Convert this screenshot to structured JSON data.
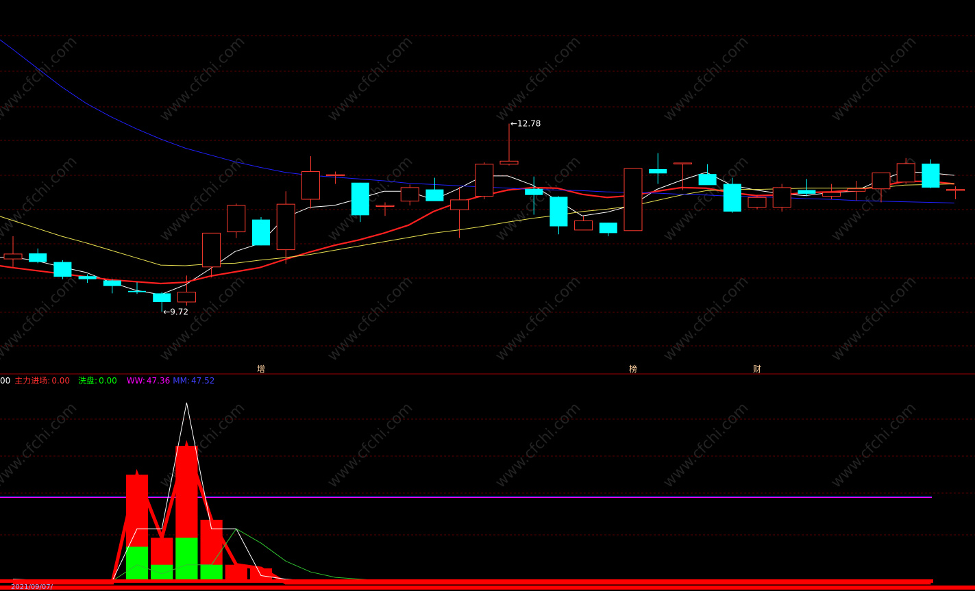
{
  "colors": {
    "background": "#000000",
    "up": "#ff3b30",
    "down": "#00ffff",
    "ma_white": "#ffffff",
    "ma_red": "#ff2020",
    "ma_yellow": "#e8e050",
    "ma_blue": "#2020ff",
    "grid": "#5a0000",
    "divider": "#a00000"
  },
  "watermark": "www.cfchi.com",
  "legend": {
    "lead": "00",
    "main_label": "主力进场:",
    "main_value": "0.00",
    "wash_label": "洗盘:",
    "wash_value": "0.00",
    "ww_label": "WW:",
    "ww_value": "47.36",
    "mm_label": "MM:",
    "mm_value": "47.52"
  },
  "date_fragment": "2021/09/07/",
  "chart_data": [
    {
      "type": "candlestick",
      "ylim": [
        9.0,
        14.3
      ],
      "annotations": [
        {
          "text": "12.78",
          "x": 20
        },
        {
          "text": "9.72",
          "x": 6
        }
      ],
      "markers": [
        {
          "text": "增",
          "x": 10
        },
        {
          "text": "榜",
          "x": 25
        },
        {
          "text": "财",
          "x": 30
        }
      ],
      "candles": [
        {
          "o": 10.58,
          "h": 10.95,
          "l": 10.45,
          "c": 10.66
        },
        {
          "o": 10.67,
          "h": 10.75,
          "l": 10.51,
          "c": 10.53
        },
        {
          "o": 10.53,
          "h": 10.56,
          "l": 10.25,
          "c": 10.29
        },
        {
          "o": 10.3,
          "h": 10.33,
          "l": 10.19,
          "c": 10.25
        },
        {
          "o": 10.23,
          "h": 10.25,
          "l": 10.02,
          "c": 10.14
        },
        {
          "o": 10.06,
          "h": 10.2,
          "l": 10.01,
          "c": 10.04
        },
        {
          "o": 10.02,
          "h": 10.04,
          "l": 9.72,
          "c": 9.88
        },
        {
          "o": 9.88,
          "h": 10.31,
          "l": 9.82,
          "c": 10.04
        },
        {
          "o": 10.45,
          "h": 10.95,
          "l": 10.28,
          "c": 11.0
        },
        {
          "o": 11.02,
          "h": 11.48,
          "l": 10.92,
          "c": 11.45
        },
        {
          "o": 11.22,
          "h": 11.26,
          "l": 10.8,
          "c": 10.8
        },
        {
          "o": 10.73,
          "h": 11.68,
          "l": 10.5,
          "c": 11.47
        },
        {
          "o": 11.55,
          "h": 12.25,
          "l": 11.4,
          "c": 12.0
        },
        {
          "o": 11.95,
          "h": 12.0,
          "l": 11.8,
          "c": 11.95
        },
        {
          "o": 11.82,
          "h": 11.82,
          "l": 11.18,
          "c": 11.29
        },
        {
          "o": 11.45,
          "h": 11.5,
          "l": 11.28,
          "c": 11.45
        },
        {
          "o": 11.52,
          "h": 11.79,
          "l": 11.45,
          "c": 11.74
        },
        {
          "o": 11.71,
          "h": 11.9,
          "l": 11.55,
          "c": 11.52
        },
        {
          "o": 11.38,
          "h": 11.75,
          "l": 10.92,
          "c": 11.54
        },
        {
          "o": 11.6,
          "h": 12.15,
          "l": 11.55,
          "c": 12.12
        },
        {
          "o": 12.12,
          "h": 12.78,
          "l": 12.1,
          "c": 12.17
        },
        {
          "o": 11.72,
          "h": 11.92,
          "l": 11.3,
          "c": 11.62
        },
        {
          "o": 11.59,
          "h": 11.6,
          "l": 10.98,
          "c": 11.11
        },
        {
          "o": 11.05,
          "h": 11.28,
          "l": 11.05,
          "c": 11.2
        },
        {
          "o": 11.17,
          "h": 11.17,
          "l": 10.95,
          "c": 11.0
        },
        {
          "o": 11.04,
          "h": 12.05,
          "l": 11.04,
          "c": 12.05
        },
        {
          "o": 12.04,
          "h": 12.3,
          "l": 11.8,
          "c": 11.97
        },
        {
          "o": 12.14,
          "h": 12.14,
          "l": 11.7,
          "c": 12.14
        },
        {
          "o": 11.96,
          "h": 12.12,
          "l": 11.85,
          "c": 11.78
        },
        {
          "o": 11.8,
          "h": 11.9,
          "l": 11.33,
          "c": 11.35
        },
        {
          "o": 11.42,
          "h": 11.62,
          "l": 11.39,
          "c": 11.58
        },
        {
          "o": 11.42,
          "h": 11.8,
          "l": 11.35,
          "c": 11.74
        },
        {
          "o": 11.7,
          "h": 11.88,
          "l": 11.6,
          "c": 11.64
        },
        {
          "o": 11.6,
          "h": 11.8,
          "l": 11.55,
          "c": 11.66
        },
        {
          "o": 11.68,
          "h": 11.85,
          "l": 11.53,
          "c": 11.72
        },
        {
          "o": 11.72,
          "h": 11.98,
          "l": 11.5,
          "c": 11.98
        },
        {
          "o": 11.83,
          "h": 12.22,
          "l": 11.8,
          "c": 12.13
        },
        {
          "o": 12.13,
          "h": 12.2,
          "l": 11.73,
          "c": 11.74
        },
        {
          "o": 11.7,
          "h": 11.76,
          "l": 11.55,
          "c": 11.71
        }
      ],
      "series": [
        {
          "values": [
            10.6,
            10.61,
            10.55,
            10.45,
            10.36,
            10.2,
            10.07,
            10.0,
            10.16,
            10.42,
            10.7,
            10.83,
            11.25,
            11.42,
            11.45,
            11.56,
            11.68,
            11.68,
            11.54,
            11.72,
            11.93,
            11.93,
            11.78,
            11.53,
            11.28,
            11.34,
            11.45,
            11.71,
            11.86,
            11.99,
            11.78,
            11.7,
            11.64,
            11.61,
            11.66,
            11.68,
            11.86,
            12.0,
            11.98,
            11.94
          ]
        },
        {
          "values": [
            10.5,
            10.44,
            10.39,
            10.34,
            10.29,
            10.24,
            10.21,
            10.18,
            10.2,
            10.3,
            10.37,
            10.44,
            10.57,
            10.69,
            10.8,
            10.89,
            11.0,
            11.13,
            11.35,
            11.5,
            11.61,
            11.7,
            11.74,
            11.73,
            11.63,
            11.58,
            11.61,
            11.68,
            11.74,
            11.73,
            11.66,
            11.61,
            11.62,
            11.66,
            11.67,
            11.7,
            11.76,
            11.84,
            11.84,
            11.8
          ]
        },
        {
          "values": [
            11.34,
            11.21,
            11.08,
            10.95,
            10.84,
            10.72,
            10.6,
            10.48,
            10.47,
            10.5,
            10.51,
            10.56,
            10.6,
            10.65,
            10.72,
            10.79,
            10.86,
            10.93,
            11.0,
            11.05,
            11.11,
            11.18,
            11.24,
            11.29,
            11.35,
            11.39,
            11.44,
            11.53,
            11.62,
            11.69,
            11.71,
            11.71,
            11.72,
            11.73,
            11.73,
            11.73,
            11.74,
            11.78,
            11.79,
            11.8
          ]
        },
        {
          "values": [
            14.3,
            14.0,
            13.69,
            13.38,
            13.11,
            12.89,
            12.7,
            12.53,
            12.38,
            12.27,
            12.16,
            12.07,
            11.99,
            11.94,
            11.91,
            11.88,
            11.85,
            11.81,
            11.79,
            11.77,
            11.75,
            11.73,
            11.71,
            11.7,
            11.69,
            11.67,
            11.66,
            11.65,
            11.63,
            11.62,
            11.6,
            11.59,
            11.58,
            11.56,
            11.55,
            11.53,
            11.52,
            11.51,
            11.5,
            11.49
          ]
        }
      ]
    },
    {
      "type": "area",
      "ylim": [
        0,
        100
      ],
      "series": [
        {
          "name": "WW",
          "values": [
            47.36,
            47.36,
            47.36,
            47.36,
            47.36,
            47.36,
            47.36,
            47.36,
            47.36,
            47.36,
            47.36,
            47.36,
            47.36,
            47.36,
            47.36,
            47.36,
            47.36,
            47.36,
            47.36,
            47.36,
            47.36,
            47.36,
            47.36,
            47.36,
            47.36,
            47.36,
            47.36,
            47.36,
            47.36,
            47.36,
            47.36,
            47.36,
            47.36,
            47.36,
            47.36,
            47.36,
            47.36
          ]
        },
        {
          "name": "MM",
          "values": [
            47.52,
            47.52,
            47.52,
            47.52,
            47.52,
            47.52,
            47.52,
            47.52,
            47.52,
            47.52,
            47.52,
            47.52,
            47.52,
            47.52,
            47.52,
            47.52,
            47.52,
            47.52,
            47.52,
            47.52,
            47.52,
            47.52,
            47.52,
            47.52,
            47.52,
            47.52,
            47.52,
            47.52,
            47.52,
            47.52,
            47.52,
            47.52,
            47.52,
            47.52,
            47.52,
            47.52,
            47.52
          ]
        },
        {
          "values": [
            2,
            1.5,
            1,
            1,
            1,
            30,
            30,
            100,
            30,
            30,
            4,
            2,
            1,
            0.5,
            0.3,
            0.3,
            0.3,
            0.3,
            0.3,
            0.3,
            0.3,
            0.3,
            0.3,
            0.3,
            0.3,
            0.3,
            0.3,
            0.3,
            0.3,
            0.3,
            0.3,
            0.3,
            0.3,
            0.3,
            0.3,
            0.3,
            0.3,
            0.3
          ]
        },
        {
          "values": [
            1.5,
            1,
            1,
            1,
            1,
            10,
            5,
            10,
            10,
            30,
            22,
            12,
            6,
            3,
            2,
            1,
            1,
            1,
            1,
            1,
            1,
            1,
            1,
            1,
            1,
            1,
            1,
            1,
            1,
            1,
            1,
            1,
            1,
            1,
            1,
            1,
            1,
            1
          ]
        },
        {
          "name": "主力进场",
          "values": [
            0,
            0,
            0,
            0,
            0,
            60,
            25,
            76,
            35,
            10,
            8,
            0,
            0,
            0,
            0,
            0,
            0,
            0,
            0,
            0,
            0,
            0,
            0,
            0,
            0,
            0,
            0,
            0,
            0,
            0,
            0,
            0,
            0,
            0,
            0,
            0,
            0,
            0
          ]
        },
        {
          "name": "洗盘",
          "values": [
            0,
            0,
            0,
            0,
            0,
            20,
            10,
            25,
            10,
            0,
            0,
            0,
            0,
            0,
            0,
            0,
            0,
            0,
            0,
            0,
            0,
            0,
            0,
            0,
            0,
            0,
            0,
            0,
            0,
            0,
            0,
            0,
            0,
            0,
            0,
            0,
            0,
            0
          ]
        }
      ]
    }
  ]
}
